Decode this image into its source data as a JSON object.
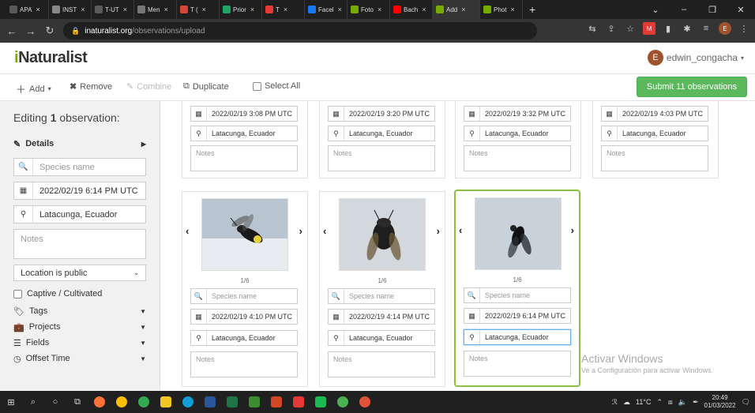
{
  "browser": {
    "tabs": [
      {
        "label": "APA",
        "color": "#5a5a5a"
      },
      {
        "label": "INST",
        "color": "#888888"
      },
      {
        "label": "T-UT",
        "color": "#5a5a5a"
      },
      {
        "label": "Men",
        "color": "#777777"
      },
      {
        "label": "T (",
        "color": "#d44638"
      },
      {
        "label": "Prior",
        "color": "#1fa463"
      },
      {
        "label": "T",
        "color": "#e53935"
      },
      {
        "label": "Facel",
        "color": "#1877f2"
      },
      {
        "label": "Foto",
        "color": "#74ac00"
      },
      {
        "label": "Bach",
        "color": "#ff0000"
      },
      {
        "label": "Add",
        "color": "#74ac00"
      },
      {
        "label": "Phot",
        "color": "#74ac00"
      }
    ],
    "url_domain": "inaturalist.org",
    "url_path": "/observations/upload"
  },
  "header": {
    "logo_prefix": "i",
    "logo_rest": "Naturalist",
    "avatar_letter": "E",
    "username": "edwin_congacha"
  },
  "toolbar": {
    "add": "Add",
    "remove": "Remove",
    "combine": "Combine",
    "duplicate": "Duplicate",
    "select_all": "Select All",
    "submit": "Submit 11 observations"
  },
  "sidebar": {
    "editing_prefix": "Editing",
    "editing_count": "1",
    "editing_suffix": "observation:",
    "details": "Details",
    "species_placeholder": "Species name",
    "date": "2022/02/19 6:14 PM UTC",
    "location": "Latacunga, Ecuador",
    "notes_placeholder": "Notes",
    "geoprivacy": "Location is public",
    "captive": "Captive / Cultivated",
    "tags": "Tags",
    "projects": "Projects",
    "fields": "Fields",
    "offset_time": "Offset Time"
  },
  "top_cards": [
    {
      "date": "2022/02/19 3:08 PM UTC",
      "location": "Latacunga, Ecuador",
      "notes": "Notes"
    },
    {
      "date": "2022/02/19 3:20 PM UTC",
      "location": "Latacunga, Ecuador",
      "notes": "Notes"
    },
    {
      "date": "2022/02/19 3:32 PM UTC",
      "location": "Latacunga, Ecuador",
      "notes": "Notes"
    },
    {
      "date": "2022/02/19 4:03 PM UTC",
      "location": "Latacunga, Ecuador",
      "notes": "Notes"
    }
  ],
  "bottom_cards": [
    {
      "count": "1/6",
      "species": "Species name",
      "date": "2022/02/19 4:10 PM UTC",
      "location": "Latacunga, Ecuador",
      "notes": "Notes"
    },
    {
      "count": "1/6",
      "species": "Species name",
      "date": "2022/02/19 4:14 PM UTC",
      "location": "Latacunga, Ecuador",
      "notes": "Notes"
    },
    {
      "count": "1/6",
      "species": "Species name",
      "date": "2022/02/19 6:14 PM UTC",
      "location": "Latacunga, Ecuador",
      "notes": "Notes"
    }
  ],
  "watermark": {
    "line1": "Activar Windows",
    "line2": "Ve a Configuración para activar Windows."
  },
  "taskbar": {
    "weather": "11°C",
    "time": "20:49",
    "date": "01/03/2022"
  },
  "colors": {
    "accent_green": "#74ac00",
    "submit_green": "#5cb85c",
    "selected_border": "#8cbf3f"
  }
}
